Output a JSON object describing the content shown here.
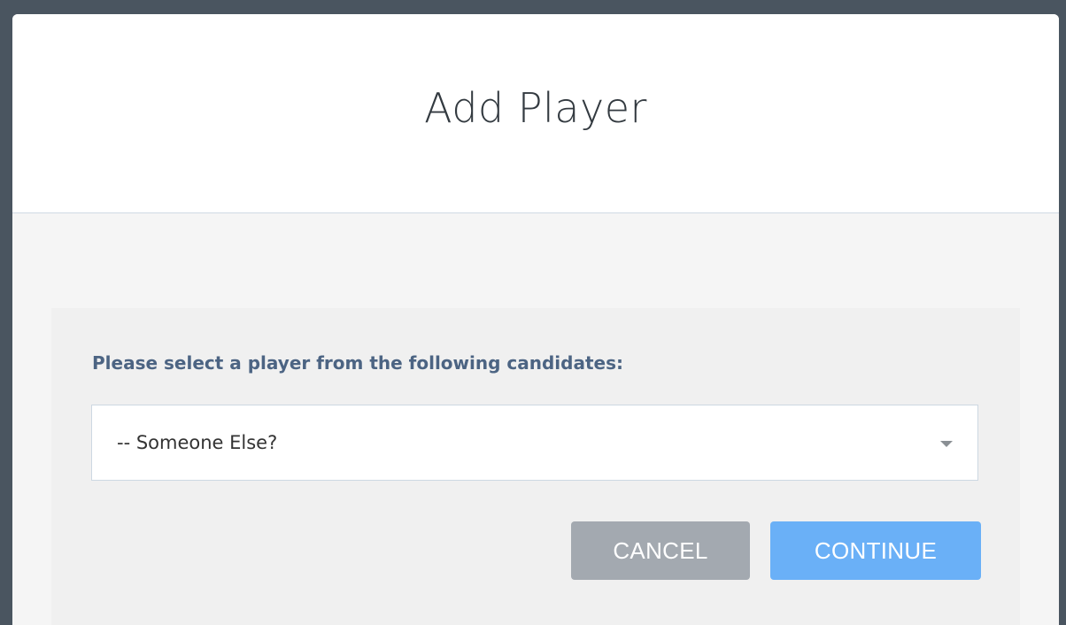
{
  "modal": {
    "title": "Add Player"
  },
  "form": {
    "prompt": "Please select a player from the following candidates:",
    "select": {
      "selected_value": "-- Someone Else?"
    }
  },
  "actions": {
    "cancel_label": "CANCEL",
    "continue_label": "CONTINUE"
  },
  "colors": {
    "backdrop": "#4a5560",
    "accent": "#6ab0f7",
    "cancel": "#a3a9b0",
    "label": "#4c6483"
  }
}
